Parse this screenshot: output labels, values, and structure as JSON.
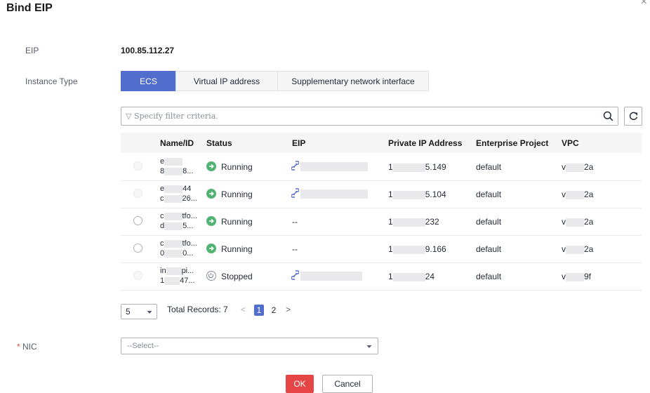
{
  "dialog": {
    "title": "Bind EIP",
    "close": "×"
  },
  "form": {
    "eip_label": "EIP",
    "eip_value": "100.85.112.27",
    "instance_type_label": "Instance Type",
    "instance_type_tabs": [
      "ECS",
      "Virtual IP address",
      "Supplementary network interface"
    ],
    "instance_type_selected": "ECS",
    "nic_required_mark": "*",
    "nic_label": "NIC",
    "nic_value": "--Select--"
  },
  "filter": {
    "placeholder": "Specify filter criteria.",
    "filter_glyph": "▽",
    "search_icon": "search-icon",
    "refresh_icon": "refresh-icon"
  },
  "table": {
    "columns": [
      "Name/ID",
      "Status",
      "EIP",
      "Private IP Address",
      "Enterprise Project",
      "VPC"
    ],
    "rows": [
      {
        "name": "e",
        "id": "8",
        "name_tail": "",
        "id_tail": "8...",
        "status": "Running",
        "eip": "",
        "private_ip_head": "1",
        "private_ip_tail": "5.149",
        "project": "default",
        "vpc_head": "v",
        "vpc_tail": "2a",
        "radio_enabled": false,
        "eip_icon": "link-icon"
      },
      {
        "name": "e",
        "id": "c",
        "name_tail": "44",
        "id_tail": "26...",
        "status": "Running",
        "eip": "",
        "private_ip_head": "1",
        "private_ip_tail": "5.104",
        "project": "default",
        "vpc_head": "v",
        "vpc_tail": "2a",
        "radio_enabled": false,
        "eip_icon": "link-icon"
      },
      {
        "name": "c",
        "id": "d",
        "name_tail": "tfo...",
        "id_tail": "5...",
        "status": "Running",
        "eip": "--",
        "private_ip_head": "1",
        "private_ip_tail": "232",
        "project": "default",
        "vpc_head": "v",
        "vpc_tail": "2a",
        "radio_enabled": true,
        "eip_icon": ""
      },
      {
        "name": "c",
        "id": "0",
        "name_tail": "tfo...",
        "id_tail": "0...",
        "status": "Running",
        "eip": "--",
        "private_ip_head": "1",
        "private_ip_tail": "9.166",
        "project": "default",
        "vpc_head": "v",
        "vpc_tail": "2a",
        "radio_enabled": true,
        "eip_icon": ""
      },
      {
        "name": "in",
        "id": "1",
        "name_tail": "pi...",
        "id_tail": "47...",
        "status": "Stopped",
        "eip": "",
        "private_ip_head": "1",
        "private_ip_tail": "24",
        "project": "default",
        "vpc_head": "v",
        "vpc_tail": "9f",
        "radio_enabled": false,
        "eip_icon": "link-icon"
      }
    ]
  },
  "pagination": {
    "page_size": "5",
    "total_records": "Total Records: 7",
    "prev": "<",
    "next": ">",
    "pages": [
      "1",
      "2"
    ],
    "current_page": "1"
  },
  "actions": {
    "ok": "OK",
    "cancel": "Cancel"
  },
  "colors": {
    "accent": "#526ecc",
    "ok_button": "#e54545",
    "running": "#50b371",
    "required": "#e54545",
    "link": "#526ecc"
  }
}
